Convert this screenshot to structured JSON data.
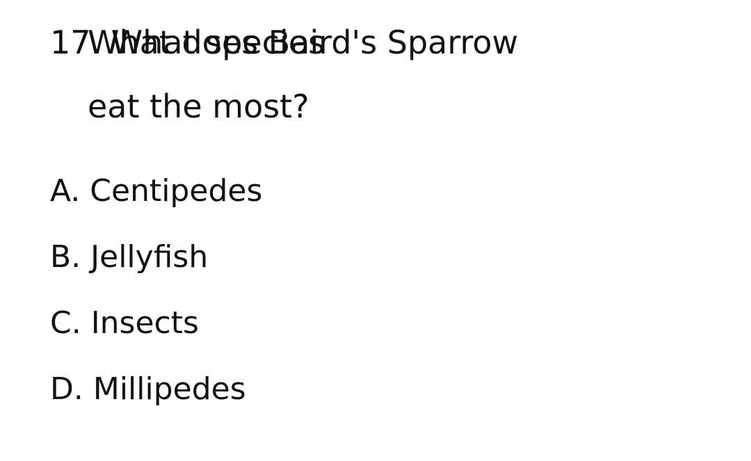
{
  "question": {
    "overlap_text_a": "17. What species",
    "overlap_text_b": "What does Baird's Sparrow",
    "continuation": "eat the most?"
  },
  "options": [
    {
      "text": "A. Centipedes"
    },
    {
      "text": "B. Jellyfish"
    },
    {
      "text": "C. Insects"
    },
    {
      "text": "D. Millipedes"
    }
  ]
}
